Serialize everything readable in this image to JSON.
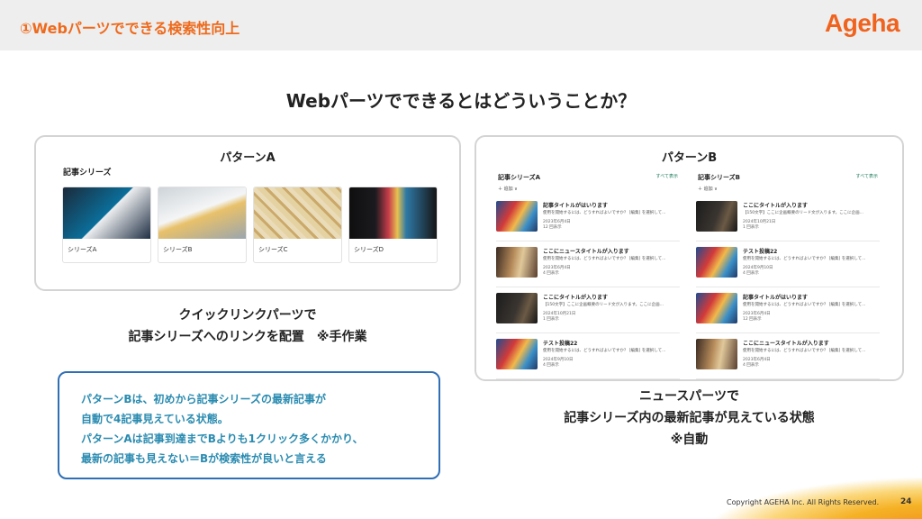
{
  "header": {
    "title": "①Webパーツでできる検索性向上",
    "logo": "Ageha"
  },
  "question": "Webパーツでできるとはどういうことか？",
  "pattern_a": {
    "title": "パターンA",
    "section": "記事シリーズ",
    "cards": [
      {
        "label": "シリーズA"
      },
      {
        "label": "シリーズB"
      },
      {
        "label": "シリーズC"
      },
      {
        "label": "シリーズD"
      }
    ],
    "caption": [
      "クイックリンクパーツで",
      "記事シリーズへのリンクを配置　※手作業"
    ]
  },
  "pattern_b": {
    "title": "パターンB",
    "columns": [
      {
        "title": "記事シリーズA",
        "see_all": "すべて表示",
        "new": "＋ 追加 ∨",
        "articles": [
          {
            "title": "記事タイトルがはいります",
            "desc": "使用を開始するには、どうすればよいですか？ [編集] を選択して...",
            "date": "2023年6月4日",
            "views": "12 回表示"
          },
          {
            "title": "ここにニュースタイトルが入ります",
            "desc": "使用を開始するには、どうすればよいですか？ [編集] を選択して...",
            "date": "2023年6月4日",
            "views": "4 回表示"
          },
          {
            "title": "ここにタイトルが入ります",
            "desc": "【150文字】ここに企画概要のリード文が入ります。ここに企画...",
            "date": "2024年10月21日",
            "views": "1 回表示"
          },
          {
            "title": "テスト投稿22",
            "desc": "使用を開始するには、どうすればよいですか？ [編集] を選択して...",
            "date": "2024年9月10日",
            "views": "4 回表示"
          }
        ]
      },
      {
        "title": "記事シリーズB",
        "see_all": "すべて表示",
        "new": "＋ 追加 ∨",
        "articles": [
          {
            "title": "ここにタイトルが入ります",
            "desc": "【150文字】ここに企画概要のリード文が入ります。ここに企画...",
            "date": "2024年10月21日",
            "views": "1 回表示"
          },
          {
            "title": "テスト投稿22",
            "desc": "使用を開始するには、どうすればよいですか？ [編集] を選択して...",
            "date": "2024年9月10日",
            "views": "4 回表示"
          },
          {
            "title": "記事タイトルがはいります",
            "desc": "使用を開始するには、どうすればよいですか？ [編集] を選択して...",
            "date": "2023年6月4日",
            "views": "12 回表示"
          },
          {
            "title": "ここにニュースタイトルが入ります",
            "desc": "使用を開始するには、どうすればよいですか？ [編集] を選択して...",
            "date": "2023年6月4日",
            "views": "4 回表示"
          }
        ]
      }
    ],
    "caption": [
      "ニュースパーツで",
      "記事シリーズ内の最新記事が見えている状態",
      "※自動"
    ]
  },
  "note": [
    "パターンBは、初めから記事シリーズの最新記事が",
    "自動で4記事見えている状態。",
    "パターンAは記事到達までBよりも1クリック多くかかり、",
    "最新の記事も見えない＝Bが検索性が良いと言える"
  ],
  "footer": {
    "copyright": "Copyright AGEHA Inc. All Rights Reserved.",
    "page": "24"
  }
}
